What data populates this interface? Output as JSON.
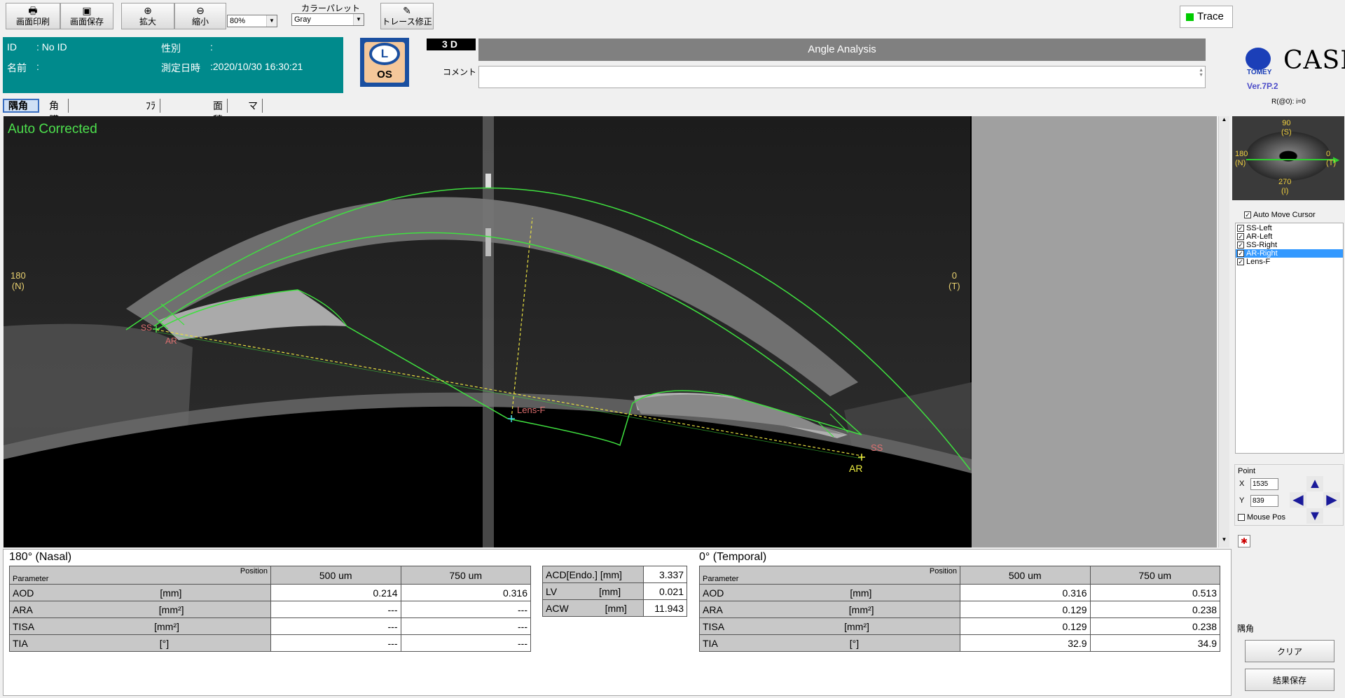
{
  "toolbar": {
    "print": "画面印刷",
    "save": "画面保存",
    "zoom_in": "拡大",
    "zoom_out": "縮小",
    "zoom_value": "80%",
    "palette_label": "カラーパレット",
    "palette_value": "Gray",
    "trace_edit": "トレース修正",
    "trace": "Trace"
  },
  "patient": {
    "id_label": "ID",
    "id_value": ": No ID",
    "sex_label": "性別",
    "sex_value": ":",
    "name_label": "名前",
    "name_value": ":",
    "date_label": "測定日時",
    "date_value": ":2020/10/30 16:30:21"
  },
  "eye": {
    "letter": "L",
    "side": "OS"
  },
  "mode": "3D",
  "title": "Angle Analysis",
  "comment_label": "コメント",
  "brand": {
    "name": "CASIA",
    "maker": "TOMEY",
    "version": "Ver.7P.2"
  },
  "r_label": "R(@0): i=0",
  "tabs": [
    "隅角",
    "角膜厚み･前房深度",
    "ﾌﾗｯﾌﾟ厚み",
    "面積",
    "マニュアル計測"
  ],
  "image": {
    "status": "Auto Corrected",
    "left_deg": "180",
    "left_dir": "(N)",
    "right_deg": "0",
    "right_dir": "(T)",
    "labels": {
      "ss": "SS",
      "ar": "AR",
      "lens": "Lens-F"
    }
  },
  "thumb": {
    "top_deg": "90",
    "top_dir": "(S)",
    "left_deg": "180",
    "left_dir": "(N)",
    "right_deg": "0",
    "right_dir": "(T)",
    "bottom_deg": "270",
    "bottom_dir": "(I)"
  },
  "cursor": {
    "auto_move": "Auto Move Cursor",
    "items": [
      "SS-Left",
      "AR-Left",
      "SS-Right",
      "AR-Right",
      "Lens-F"
    ],
    "selected": 3
  },
  "point": {
    "label": "Point",
    "x_label": "X",
    "x_value": "1535",
    "y_label": "Y",
    "y_value": "839",
    "mouse_pos": "Mouse Pos"
  },
  "nasal": {
    "title": "180° (Nasal)",
    "param_h": "Parameter",
    "pos_h": "Position",
    "c1": "500 um",
    "c2": "750 um",
    "rows": [
      {
        "p": "AOD",
        "u": "[mm]",
        "a": "0.214",
        "b": "0.316"
      },
      {
        "p": "ARA",
        "u": "[mm²]",
        "a": "---",
        "b": "---"
      },
      {
        "p": "TISA",
        "u": "[mm²]",
        "a": "---",
        "b": "---"
      },
      {
        "p": "TIA",
        "u": "[°]",
        "a": "---",
        "b": "---"
      }
    ]
  },
  "mid": {
    "rows": [
      {
        "p": "ACD[Endo.]",
        "u": "[mm]",
        "v": "3.337"
      },
      {
        "p": "LV",
        "u": "[mm]",
        "v": "0.021"
      },
      {
        "p": "ACW",
        "u": "[mm]",
        "v": "11.943"
      }
    ]
  },
  "temporal": {
    "title": "0° (Temporal)",
    "param_h": "Parameter",
    "pos_h": "Position",
    "c1": "500 um",
    "c2": "750 um",
    "rows": [
      {
        "p": "AOD",
        "u": "[mm]",
        "a": "0.316",
        "b": "0.513"
      },
      {
        "p": "ARA",
        "u": "[mm²]",
        "a": "0.129",
        "b": "0.238"
      },
      {
        "p": "TISA",
        "u": "[mm²]",
        "a": "0.129",
        "b": "0.238"
      },
      {
        "p": "TIA",
        "u": "[°]",
        "a": "32.9",
        "b": "34.9"
      }
    ]
  },
  "side": {
    "section": "隅角",
    "clear": "クリア",
    "save": "結果保存"
  }
}
